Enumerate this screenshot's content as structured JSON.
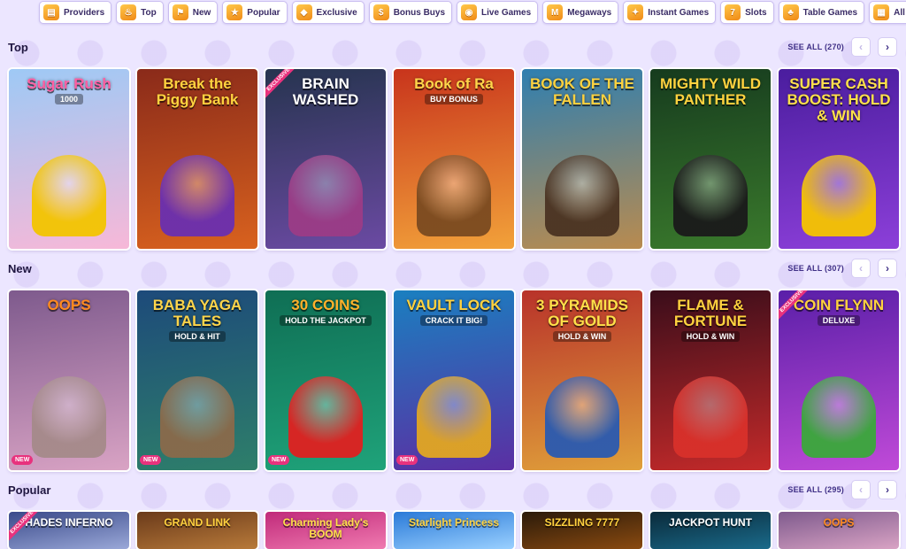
{
  "categories": [
    {
      "label": "Providers",
      "icon": "book-icon",
      "glyph": "▤"
    },
    {
      "label": "Top",
      "icon": "flame-icon",
      "glyph": "♨"
    },
    {
      "label": "New",
      "icon": "flag-icon",
      "glyph": "⚑"
    },
    {
      "label": "Popular",
      "icon": "star-icon",
      "glyph": "★"
    },
    {
      "label": "Exclusive",
      "icon": "diamond-icon",
      "glyph": "◆"
    },
    {
      "label": "Bonus Buys",
      "icon": "bag-icon",
      "glyph": "$"
    },
    {
      "label": "Live Games",
      "icon": "chip-icon",
      "glyph": "◉"
    },
    {
      "label": "Megaways",
      "icon": "megaways-icon",
      "glyph": "M"
    },
    {
      "label": "Instant Games",
      "icon": "joystick-icon",
      "glyph": "✦"
    },
    {
      "label": "Slots",
      "icon": "slot-icon",
      "glyph": "7"
    },
    {
      "label": "Table Games",
      "icon": "cherries-icon",
      "glyph": "♣"
    },
    {
      "label": "All Games",
      "icon": "grid-icon",
      "glyph": "▦"
    }
  ],
  "sections": {
    "top": {
      "title": "Top",
      "see_all": "SEE ALL (270)",
      "games": [
        {
          "title": "Sugar Rush",
          "sub": "1000",
          "bg": "#9ec9f5",
          "bg2": "#f7b8d8",
          "fg": "#ff5fa2",
          "art": "#f3c400",
          "badge": "",
          "ribbon": ""
        },
        {
          "title": "Break the Piggy Bank",
          "sub": "",
          "bg": "#8a2a1a",
          "bg2": "#d9621e",
          "fg": "#ffd23f",
          "art": "#6a2fb0",
          "badge": "",
          "ribbon": ""
        },
        {
          "title": "BRAIN WASHED",
          "sub": "",
          "bg": "#26344f",
          "bg2": "#6b4aa3",
          "fg": "#ffffff",
          "art": "#9b3c86",
          "badge": "",
          "ribbon": "EXCLUSIVE"
        },
        {
          "title": "Book of Ra",
          "sub": "BUY BONUS",
          "bg": "#c8341c",
          "bg2": "#f2a23a",
          "fg": "#ffd54a",
          "art": "#7a4a20",
          "badge": "",
          "ribbon": ""
        },
        {
          "title": "BOOK OF THE FALLEN",
          "sub": "",
          "bg": "#2f7fb0",
          "bg2": "#b98b4f",
          "fg": "#ffd23f",
          "art": "#4a3322",
          "badge": "",
          "ribbon": ""
        },
        {
          "title": "MIGHTY WILD PANTHER",
          "sub": "",
          "bg": "#163b1e",
          "bg2": "#3a7a2c",
          "fg": "#ffd23f",
          "art": "#1a1a1a",
          "badge": "",
          "ribbon": ""
        },
        {
          "title": "SUPER CASH BOOST: HOLD & WIN",
          "sub": "",
          "bg": "#4a1d9e",
          "bg2": "#8c3fd9",
          "fg": "#ffe14a",
          "art": "#f6c400",
          "badge": "",
          "ribbon": ""
        }
      ]
    },
    "new": {
      "title": "New",
      "see_all": "SEE ALL (307)",
      "games": [
        {
          "title": "OOPS",
          "sub": "",
          "bg": "#7e5a8d",
          "bg2": "#d9a3c4",
          "fg": "#ff8a1f",
          "art": "#a58a8a",
          "badge": "NEW",
          "ribbon": ""
        },
        {
          "title": "BABA YAGA TALES",
          "sub": "HOLD & HIT",
          "bg": "#1d4a7a",
          "bg2": "#2e7f6a",
          "fg": "#ffd54a",
          "art": "#8a6a4a",
          "badge": "NEW",
          "ribbon": ""
        },
        {
          "title": "30 COINS",
          "sub": "HOLD THE JACKPOT",
          "bg": "#0f6e54",
          "bg2": "#1fa37a",
          "fg": "#ffb12a",
          "art": "#e02020",
          "badge": "NEW",
          "ribbon": ""
        },
        {
          "title": "VAULT LOCK",
          "sub": "CRACK IT BIG!",
          "bg": "#1a7fc0",
          "bg2": "#5b2fa3",
          "fg": "#ffd23f",
          "art": "#e2a622",
          "badge": "NEW",
          "ribbon": ""
        },
        {
          "title": "3 PYRAMIDS OF GOLD",
          "sub": "HOLD & WIN",
          "bg": "#b8322a",
          "bg2": "#e0a03a",
          "fg": "#ffe14a",
          "art": "#2a5ab0",
          "badge": "",
          "ribbon": ""
        },
        {
          "title": "FLAME & FORTUNE",
          "sub": "HOLD & WIN",
          "bg": "#3a0d1a",
          "bg2": "#c42a2a",
          "fg": "#ffd23f",
          "art": "#d8302a",
          "badge": "",
          "ribbon": ""
        },
        {
          "title": "COIN FLYNN",
          "sub": "DELUXE",
          "bg": "#5a1fa8",
          "bg2": "#c04ad8",
          "fg": "#ffd23f",
          "art": "#3aa83a",
          "badge": "",
          "ribbon": "EXCLUSIVE"
        }
      ]
    },
    "popular": {
      "title": "Popular",
      "see_all": "SEE ALL (295)",
      "games": [
        {
          "title": "HADES INFERNO",
          "bg": "#3a4a8a",
          "bg2": "#9aa8d8",
          "fg": "#ffffff",
          "ribbon": "EXCLUSIVE"
        },
        {
          "title": "GRAND LINK",
          "bg": "#6a3a1a",
          "bg2": "#b87a3a",
          "fg": "#ffd23f",
          "ribbon": ""
        },
        {
          "title": "Charming Lady's BOOM",
          "bg": "#c02a7a",
          "bg2": "#f07ab0",
          "fg": "#ffe14a",
          "ribbon": ""
        },
        {
          "title": "Starlight Princess",
          "bg": "#2a7ad8",
          "bg2": "#9ad0ff",
          "fg": "#ffd23f",
          "ribbon": ""
        },
        {
          "title": "SIZZLING 7777",
          "bg": "#2a1a0a",
          "bg2": "#8a4a10",
          "fg": "#ffd23f",
          "ribbon": ""
        },
        {
          "title": "JACKPOT HUNT",
          "bg": "#0a2a3a",
          "bg2": "#1a6a8a",
          "fg": "#ffffff",
          "ribbon": ""
        },
        {
          "title": "OOPS",
          "bg": "#7e5a8d",
          "bg2": "#d9a3c4",
          "fg": "#ff8a1f",
          "ribbon": ""
        }
      ]
    }
  },
  "nav": {
    "prev": "‹",
    "next": "›"
  }
}
